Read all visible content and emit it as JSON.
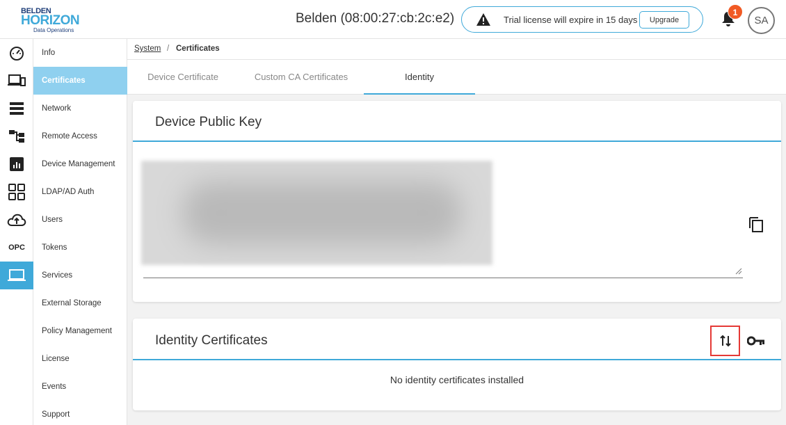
{
  "logo": {
    "line1": "BELDEN",
    "line2": "HORIZON",
    "line3": "Data Operations"
  },
  "header": {
    "device_title": "Belden (08:00:27:cb:2c:e2)",
    "trial_message": "Trial license will expire in 15 days",
    "upgrade_label": "Upgrade",
    "notification_count": "1",
    "avatar_initials": "SA"
  },
  "rail": {
    "items": [
      {
        "icon": "dashboard-gauge-icon"
      },
      {
        "icon": "devices-icon"
      },
      {
        "icon": "storage-list-icon"
      },
      {
        "icon": "hierarchy-icon"
      },
      {
        "icon": "analytics-chart-icon"
      },
      {
        "icon": "apps-grid-icon"
      },
      {
        "icon": "cloud-upload-icon"
      },
      {
        "icon": "opc-icon",
        "label": "OPC"
      },
      {
        "icon": "laptop-icon",
        "active": true
      }
    ]
  },
  "submenu": {
    "items": [
      {
        "label": "Info"
      },
      {
        "label": "Certificates",
        "active": true
      },
      {
        "label": "Network"
      },
      {
        "label": "Remote Access"
      },
      {
        "label": "Device Management"
      },
      {
        "label": "LDAP/AD Auth"
      },
      {
        "label": "Users"
      },
      {
        "label": "Tokens"
      },
      {
        "label": "Services"
      },
      {
        "label": "External Storage"
      },
      {
        "label": "Policy Management"
      },
      {
        "label": "License"
      },
      {
        "label": "Events"
      },
      {
        "label": "Support"
      }
    ]
  },
  "breadcrumb": {
    "parent": "System",
    "separator": "/",
    "current": "Certificates"
  },
  "tabs": [
    {
      "label": "Device Certificate"
    },
    {
      "label": "Custom CA Certificates"
    },
    {
      "label": "Identity",
      "active": true
    }
  ],
  "public_key_card": {
    "title": "Device Public Key",
    "key_value": ""
  },
  "identity_card": {
    "title": "Identity Certificates",
    "empty_message": "No identity certificates installed"
  },
  "colors": {
    "accent": "#3fa9d9",
    "submenu_active": "#8fd0ef",
    "badge": "#f15a24",
    "highlight": "#e53935"
  }
}
